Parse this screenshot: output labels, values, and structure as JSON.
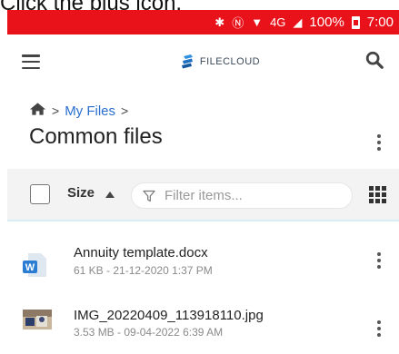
{
  "caption": "Click the plus icon.",
  "status_bar": {
    "icons": [
      "bluetooth-icon",
      "nfc-icon",
      "wifi-icon",
      "signal-icon"
    ],
    "network": "4G",
    "battery": "100%",
    "time": "7:00",
    "color": "#e9121a"
  },
  "app_bar": {
    "brand": "FILECLOUD"
  },
  "breadcrumb": {
    "home_icon": "home-icon",
    "items": [
      "My Files"
    ]
  },
  "folder": {
    "title": "Common files"
  },
  "toolbar": {
    "sort_label": "Size",
    "sort_direction": "ascending",
    "filter_placeholder": "Filter items...",
    "view_icon": "grid-view-icon"
  },
  "files": [
    {
      "name": "Annuity template.docx",
      "meta": "61 KB - 21-12-2020 1:37 PM",
      "type_icon": "word-doc-icon"
    },
    {
      "name": "IMG_20220409_113918110.jpg",
      "meta": "3.53 MB - 09-04-2022 6:39 AM",
      "type_icon": "image-thumbnail"
    }
  ],
  "colors": {
    "accent": "#2a6fcf",
    "word": "#2b7cd3"
  }
}
